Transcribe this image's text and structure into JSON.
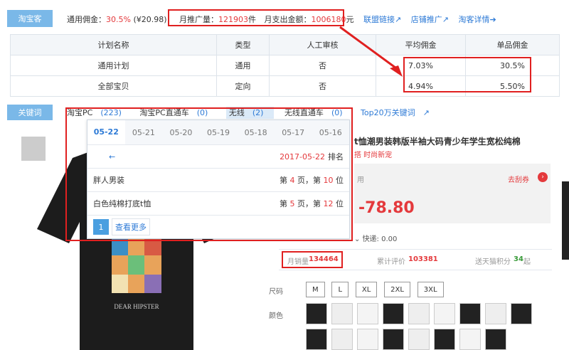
{
  "top": {
    "tag": "淘宝客",
    "commission_label": "通用佣金：",
    "commission_rate": "30.5%",
    "commission_amount": "(¥20.98)",
    "promo_label": "月推广量：",
    "promo_value": "121903",
    "promo_unit": "件",
    "pay_label": "月支出金额：",
    "pay_value": "1006180",
    "pay_unit": "元",
    "links": [
      "联盟链接",
      "店铺推广",
      "淘客详情"
    ]
  },
  "plan_table": {
    "headers": [
      "计划名称",
      "类型",
      "人工审核",
      "平均佣金",
      "单品佣金"
    ],
    "rows": [
      [
        "通用计划",
        "通用",
        "否",
        "7.03%",
        "30.5%"
      ],
      [
        "全部宝贝",
        "定向",
        "否",
        "4.94%",
        "5.50%"
      ]
    ]
  },
  "keywords": {
    "tag": "关键词",
    "tabs": [
      {
        "label": "淘宝PC",
        "count": "(223)"
      },
      {
        "label": "淘宝PC直通车",
        "count": "(0)"
      },
      {
        "label": "无线",
        "count": "(2)"
      },
      {
        "label": "无线直通车",
        "count": "(0)"
      },
      {
        "label": "Top20万关键词",
        "count": ""
      }
    ]
  },
  "popup": {
    "dates": [
      "05-22",
      "05-21",
      "05-20",
      "05-19",
      "05-18",
      "05-17",
      "05-16"
    ],
    "header_arrow": "←",
    "header_date": "2017-05-22",
    "header_rank": "排名",
    "rows": [
      {
        "kw": "胖人男装",
        "pre": "第 ",
        "page": "4",
        "mid": " 页，第 ",
        "pos": "10",
        "post": " 位"
      },
      {
        "kw": "白色纯棉打底t恤",
        "pre": "第 ",
        "page": "5",
        "mid": " 页，第 ",
        "pos": "12",
        "post": " 位"
      }
    ],
    "page_num": "1",
    "more": "查看更多"
  },
  "product": {
    "title": "t恤潮男装韩版半袖大码青少年学生宽松纯棉",
    "sub": "搭 时尚新宠",
    "coupon_text": "去刮券",
    "price": "-78.80",
    "side_label": "用",
    "shipping": "快递: 0.00",
    "shirt_text": "DEAR HIPSTER",
    "sales_label": "月销量",
    "sales_value": "134464",
    "review_label": "累计评价",
    "review_value": "103381",
    "points_label": "送天猫积分",
    "points_value": "34",
    "points_suffix": "起",
    "size_label": "尺码",
    "sizes": [
      "M",
      "L",
      "XL",
      "2XL",
      "3XL"
    ],
    "color_label": "颜色"
  },
  "colors": {
    "accent": "#7ab8e8",
    "red": "#e4393c",
    "link": "#2d7ad6"
  }
}
